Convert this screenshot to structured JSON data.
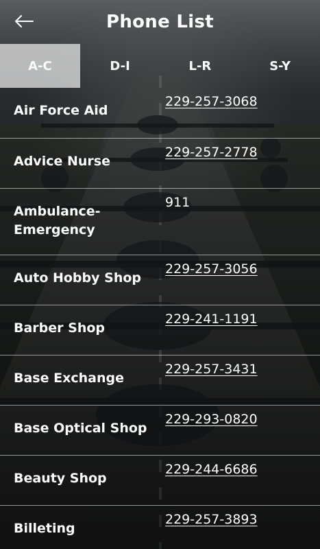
{
  "header": {
    "title": "Phone List",
    "back_icon": "arrow-left-icon"
  },
  "tabs": [
    {
      "label": "A-C",
      "active": true
    },
    {
      "label": "D-I",
      "active": false
    },
    {
      "label": "L-R",
      "active": false
    },
    {
      "label": "S-Y",
      "active": false
    }
  ],
  "entries": [
    {
      "name": "Air Force Aid",
      "phone": "229-257-3068",
      "link": true
    },
    {
      "name": "Advice Nurse",
      "phone": "229-257-2778",
      "link": true
    },
    {
      "name": "Ambulance-Emergency",
      "phone": "911",
      "link": false
    },
    {
      "name": "Auto Hobby Shop",
      "phone": "229-257-3056",
      "link": true
    },
    {
      "name": "Barber Shop",
      "phone": "229-241-1191",
      "link": true
    },
    {
      "name": "Base Exchange",
      "phone": "229-257-3431",
      "link": true
    },
    {
      "name": "Base Optical Shop",
      "phone": "229-293-0820",
      "link": true
    },
    {
      "name": "Beauty Shop",
      "phone": "229-244-6686",
      "link": true
    },
    {
      "name": "Billeting",
      "phone": "229-257-3893",
      "link": true
    }
  ]
}
